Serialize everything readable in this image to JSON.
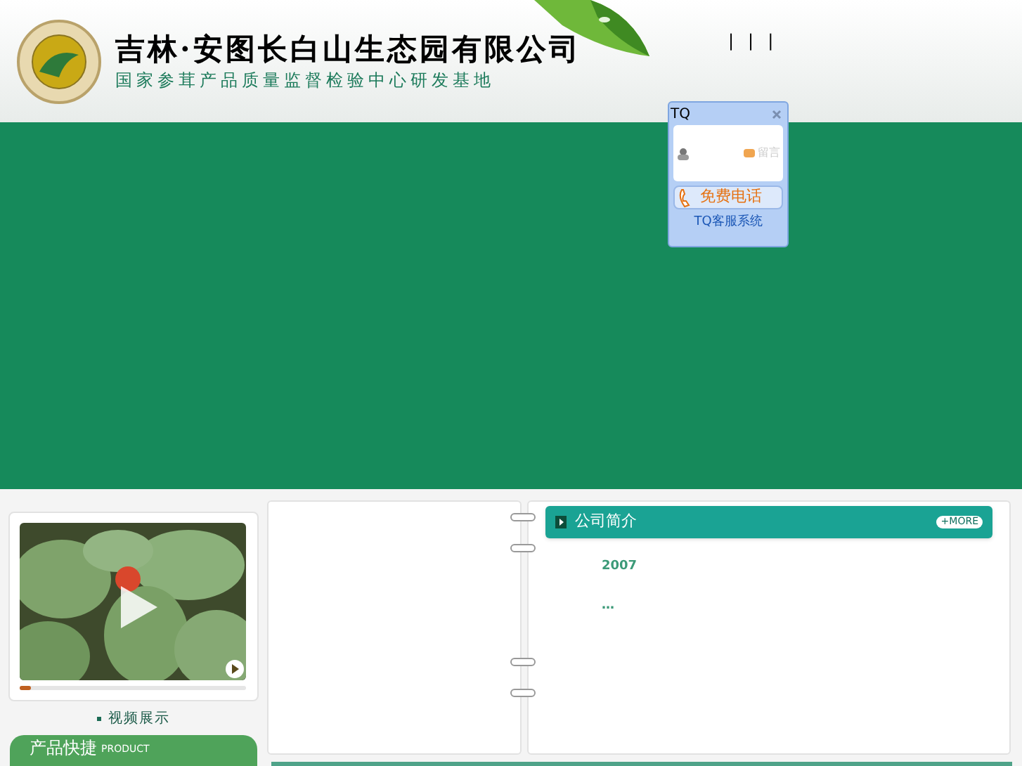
{
  "header": {
    "company_name": "吉林·安图长白山生态园有限公司",
    "subtitle": "国家参茸产品质量监督检验中心研发基地",
    "nav": [
      "|",
      "|",
      "|"
    ]
  },
  "chat_widget": {
    "title": "TQ",
    "message_label": "留言",
    "call_button": "免费电话",
    "footer": "TQ客服系统"
  },
  "video": {
    "caption": "视频展示",
    "level": 0.05
  },
  "product_panel": {
    "title": "产品快捷",
    "subtitle": "PRODUCT"
  },
  "about": {
    "title": "公司简介",
    "more": "+MORE",
    "lines": [
      "2007",
      "…"
    ]
  }
}
